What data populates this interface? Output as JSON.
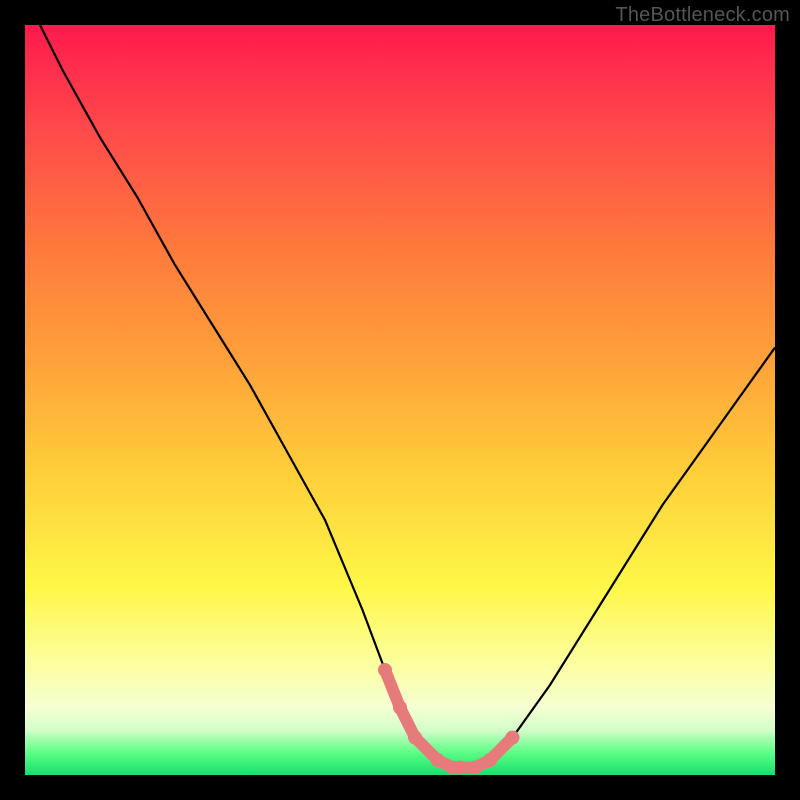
{
  "watermark": "TheBottleneck.com",
  "colors": {
    "page_bg": "#000000",
    "curve_stroke": "#000000",
    "highlight_fill": "#e77a7a",
    "highlight_stroke": "#e77a7a"
  },
  "chart_data": {
    "type": "line",
    "title": "",
    "xlabel": "",
    "ylabel": "",
    "xlim": [
      0,
      100
    ],
    "ylim": [
      0,
      100
    ],
    "grid": false,
    "legend": false,
    "series": [
      {
        "name": "bottleneck-curve",
        "x": [
          2,
          5,
          10,
          15,
          20,
          25,
          30,
          35,
          40,
          45,
          48,
          50,
          52,
          55,
          57,
          58,
          60,
          62,
          65,
          70,
          75,
          80,
          85,
          90,
          95,
          100
        ],
        "y": [
          100,
          94,
          85,
          77,
          68,
          60,
          52,
          43,
          34,
          22,
          14,
          9,
          5,
          2,
          1,
          1,
          1,
          2,
          5,
          12,
          20,
          28,
          36,
          43,
          50,
          57
        ]
      }
    ],
    "highlight_points": {
      "name": "selected-range",
      "x": [
        48,
        50,
        52,
        55,
        57,
        58,
        60,
        62,
        65
      ],
      "y": [
        14,
        9,
        5,
        2,
        1,
        1,
        1,
        2,
        5
      ]
    }
  }
}
